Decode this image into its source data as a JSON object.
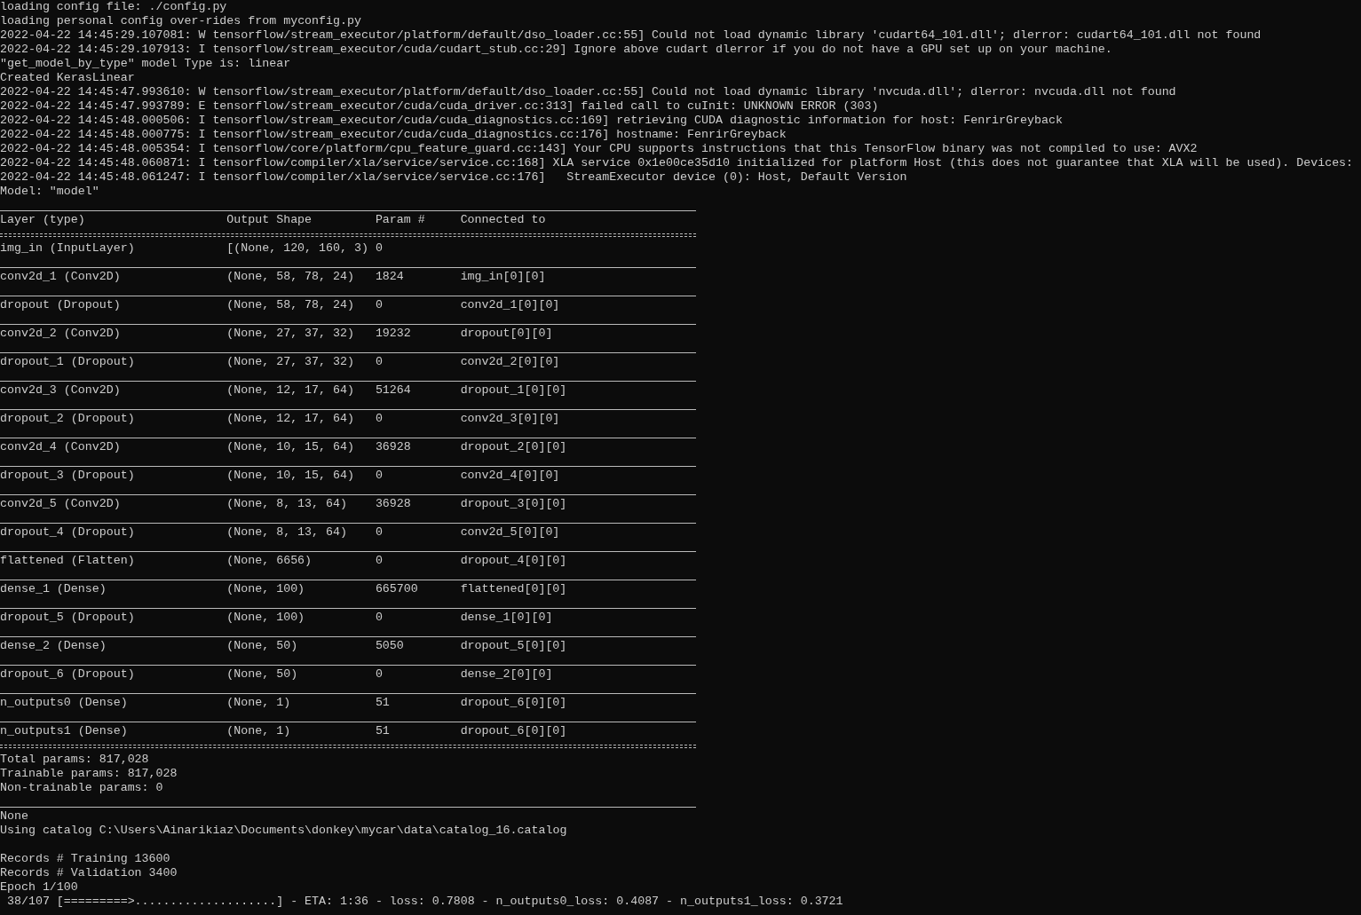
{
  "log_lines": [
    "loading config file: ./config.py",
    "loading personal config over-rides from myconfig.py",
    "2022-04-22 14:45:29.107081: W tensorflow/stream_executor/platform/default/dso_loader.cc:55] Could not load dynamic library 'cudart64_101.dll'; dlerror: cudart64_101.dll not found",
    "2022-04-22 14:45:29.107913: I tensorflow/stream_executor/cuda/cudart_stub.cc:29] Ignore above cudart dlerror if you do not have a GPU set up on your machine.",
    "\"get_model_by_type\" model Type is: linear",
    "Created KerasLinear",
    "2022-04-22 14:45:47.993610: W tensorflow/stream_executor/platform/default/dso_loader.cc:55] Could not load dynamic library 'nvcuda.dll'; dlerror: nvcuda.dll not found",
    "2022-04-22 14:45:47.993789: E tensorflow/stream_executor/cuda/cuda_driver.cc:313] failed call to cuInit: UNKNOWN ERROR (303)",
    "2022-04-22 14:45:48.000506: I tensorflow/stream_executor/cuda/cuda_diagnostics.cc:169] retrieving CUDA diagnostic information for host: FenrirGreyback",
    "2022-04-22 14:45:48.000775: I tensorflow/stream_executor/cuda/cuda_diagnostics.cc:176] hostname: FenrirGreyback",
    "2022-04-22 14:45:48.005354: I tensorflow/core/platform/cpu_feature_guard.cc:143] Your CPU supports instructions that this TensorFlow binary was not compiled to use: AVX2",
    "2022-04-22 14:45:48.060871: I tensorflow/compiler/xla/service/service.cc:168] XLA service 0x1e00ce35d10 initialized for platform Host (this does not guarantee that XLA will be used). Devices:",
    "2022-04-22 14:45:48.061247: I tensorflow/compiler/xla/service/service.cc:176]   StreamExecutor device (0): Host, Default Version",
    "Model: \"model\""
  ],
  "model_summary": {
    "columns": [
      "Layer (type)",
      "Output Shape",
      "Param #",
      "Connected to"
    ],
    "rows": [
      {
        "layer": "img_in (InputLayer)",
        "output_shape": "[(None, 120, 160, 3)",
        "params": "0"
      },
      {
        "layer": "conv2d_1 (Conv2D)",
        "output_shape": "(None, 58, 78, 24)",
        "params": "1824",
        "connected_to": "img_in[0][0]"
      },
      {
        "layer": "dropout (Dropout)",
        "output_shape": "(None, 58, 78, 24)",
        "params": "0",
        "connected_to": "conv2d_1[0][0]"
      },
      {
        "layer": "conv2d_2 (Conv2D)",
        "output_shape": "(None, 27, 37, 32)",
        "params": "19232",
        "connected_to": "dropout[0][0]"
      },
      {
        "layer": "dropout_1 (Dropout)",
        "output_shape": "(None, 27, 37, 32)",
        "params": "0",
        "connected_to": "conv2d_2[0][0]"
      },
      {
        "layer": "conv2d_3 (Conv2D)",
        "output_shape": "(None, 12, 17, 64)",
        "params": "51264",
        "connected_to": "dropout_1[0][0]"
      },
      {
        "layer": "dropout_2 (Dropout)",
        "output_shape": "(None, 12, 17, 64)",
        "params": "0",
        "connected_to": "conv2d_3[0][0]"
      },
      {
        "layer": "conv2d_4 (Conv2D)",
        "output_shape": "(None, 10, 15, 64)",
        "params": "36928",
        "connected_to": "dropout_2[0][0]"
      },
      {
        "layer": "dropout_3 (Dropout)",
        "output_shape": "(None, 10, 15, 64)",
        "params": "0",
        "connected_to": "conv2d_4[0][0]"
      },
      {
        "layer": "conv2d_5 (Conv2D)",
        "output_shape": "(None, 8, 13, 64)",
        "params": "36928",
        "connected_to": "dropout_3[0][0]"
      },
      {
        "layer": "dropout_4 (Dropout)",
        "output_shape": "(None, 8, 13, 64)",
        "params": "0",
        "connected_to": "conv2d_5[0][0]"
      },
      {
        "layer": "flattened (Flatten)",
        "output_shape": "(None, 6656)",
        "params": "0",
        "connected_to": "dropout_4[0][0]"
      },
      {
        "layer": "dense_1 (Dense)",
        "output_shape": "(None, 100)",
        "params": "665700",
        "connected_to": "flattened[0][0]"
      },
      {
        "layer": "dropout_5 (Dropout)",
        "output_shape": "(None, 100)",
        "params": "0",
        "connected_to": "dense_1[0][0]"
      },
      {
        "layer": "dense_2 (Dense)",
        "output_shape": "(None, 50)",
        "params": "5050",
        "connected_to": "dropout_5[0][0]"
      },
      {
        "layer": "dropout_6 (Dropout)",
        "output_shape": "(None, 50)",
        "params": "0",
        "connected_to": "dense_2[0][0]"
      },
      {
        "layer": "n_outputs0 (Dense)",
        "output_shape": "(None, 1)",
        "params": "51",
        "connected_to": "dropout_6[0][0]"
      },
      {
        "layer": "n_outputs1 (Dense)",
        "output_shape": "(None, 1)",
        "params": "51",
        "connected_to": "dropout_6[0][0]"
      }
    ],
    "totals": [
      "Total params: 817,028",
      "Trainable params: 817,028",
      "Non-trainable params: 0"
    ]
  },
  "output_blocks": [
    [
      "None",
      "Using catalog C:\\Users\\Ainarikiaz\\Documents\\donkey\\mycar\\data\\catalog_16.catalog"
    ],
    [
      "Records # Training 13600",
      "Records # Validation 3400",
      "Epoch 1/100",
      " 38/107 [=========>....................] - ETA: 1:36 - loss: 0.7808 - n_outputs0_loss: 0.4087 - n_outputs1_loss: 0.3721"
    ]
  ]
}
